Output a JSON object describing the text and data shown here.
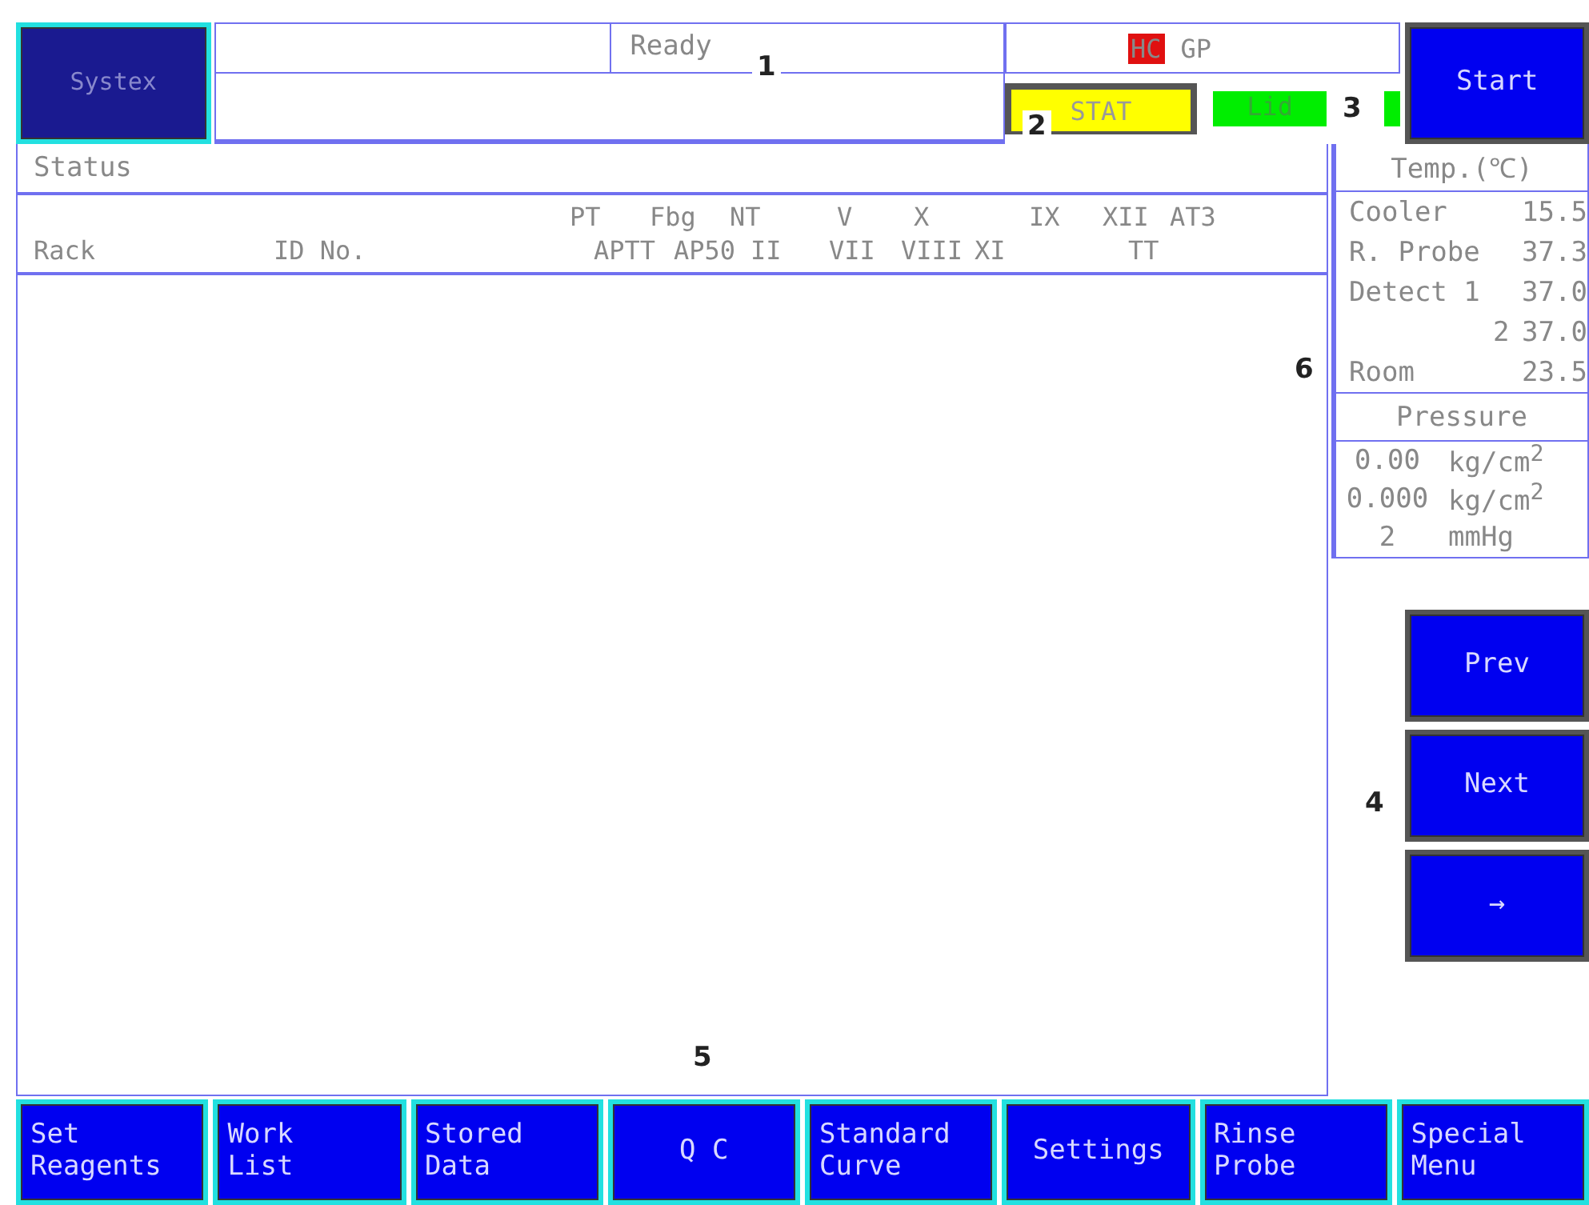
{
  "header": {
    "system_button": "Systex",
    "status_text": "Ready",
    "mode_badges": [
      {
        "label": "HC",
        "color": "#e01010"
      },
      {
        "label": "GP",
        "color": "#ffffff"
      }
    ],
    "stat_button": "STAT",
    "lid_indicator": "Lid",
    "start_button": "Start"
  },
  "status_panel": {
    "title": "Status",
    "columns_upper": [
      "PT",
      "Fbg",
      "NT",
      "V",
      "X",
      "IX",
      "XII",
      "AT3"
    ],
    "columns_lower": [
      "Rack",
      "ID No.",
      "APTT",
      "AP50",
      "II",
      "VII",
      "VIII",
      "XI",
      "TT"
    ]
  },
  "temperature": {
    "title": "Temp.(℃)",
    "rows": [
      {
        "label": "Cooler",
        "value": "15.5"
      },
      {
        "label": "R. Probe",
        "value": "37.3"
      },
      {
        "label": "Detect 1",
        "value": "37.0"
      },
      {
        "label": "2",
        "value": "37.0"
      },
      {
        "label": "Room",
        "value": "23.5"
      }
    ]
  },
  "pressure": {
    "title": "Pressure",
    "rows": [
      {
        "value": "0.00",
        "unit": "kg/cm$^{2}$"
      },
      {
        "value": "0.000",
        "unit": "kg/cm$^{2}$"
      },
      {
        "value": "2",
        "unit": "mmHg"
      }
    ]
  },
  "nav_buttons": [
    "Prev",
    "Next",
    "→"
  ],
  "callouts": [
    "1",
    "2",
    "3",
    "4",
    "5",
    "6"
  ],
  "menu_buttons": [
    [
      "Set",
      "Reagents"
    ],
    [
      "Work",
      "List"
    ],
    [
      "Stored",
      "Data"
    ],
    [
      "Q C"
    ],
    [
      "Standard",
      "Curve"
    ],
    [
      "Settings"
    ],
    [
      "Rinse",
      "Probe"
    ],
    [
      "Special",
      "Menu"
    ]
  ]
}
